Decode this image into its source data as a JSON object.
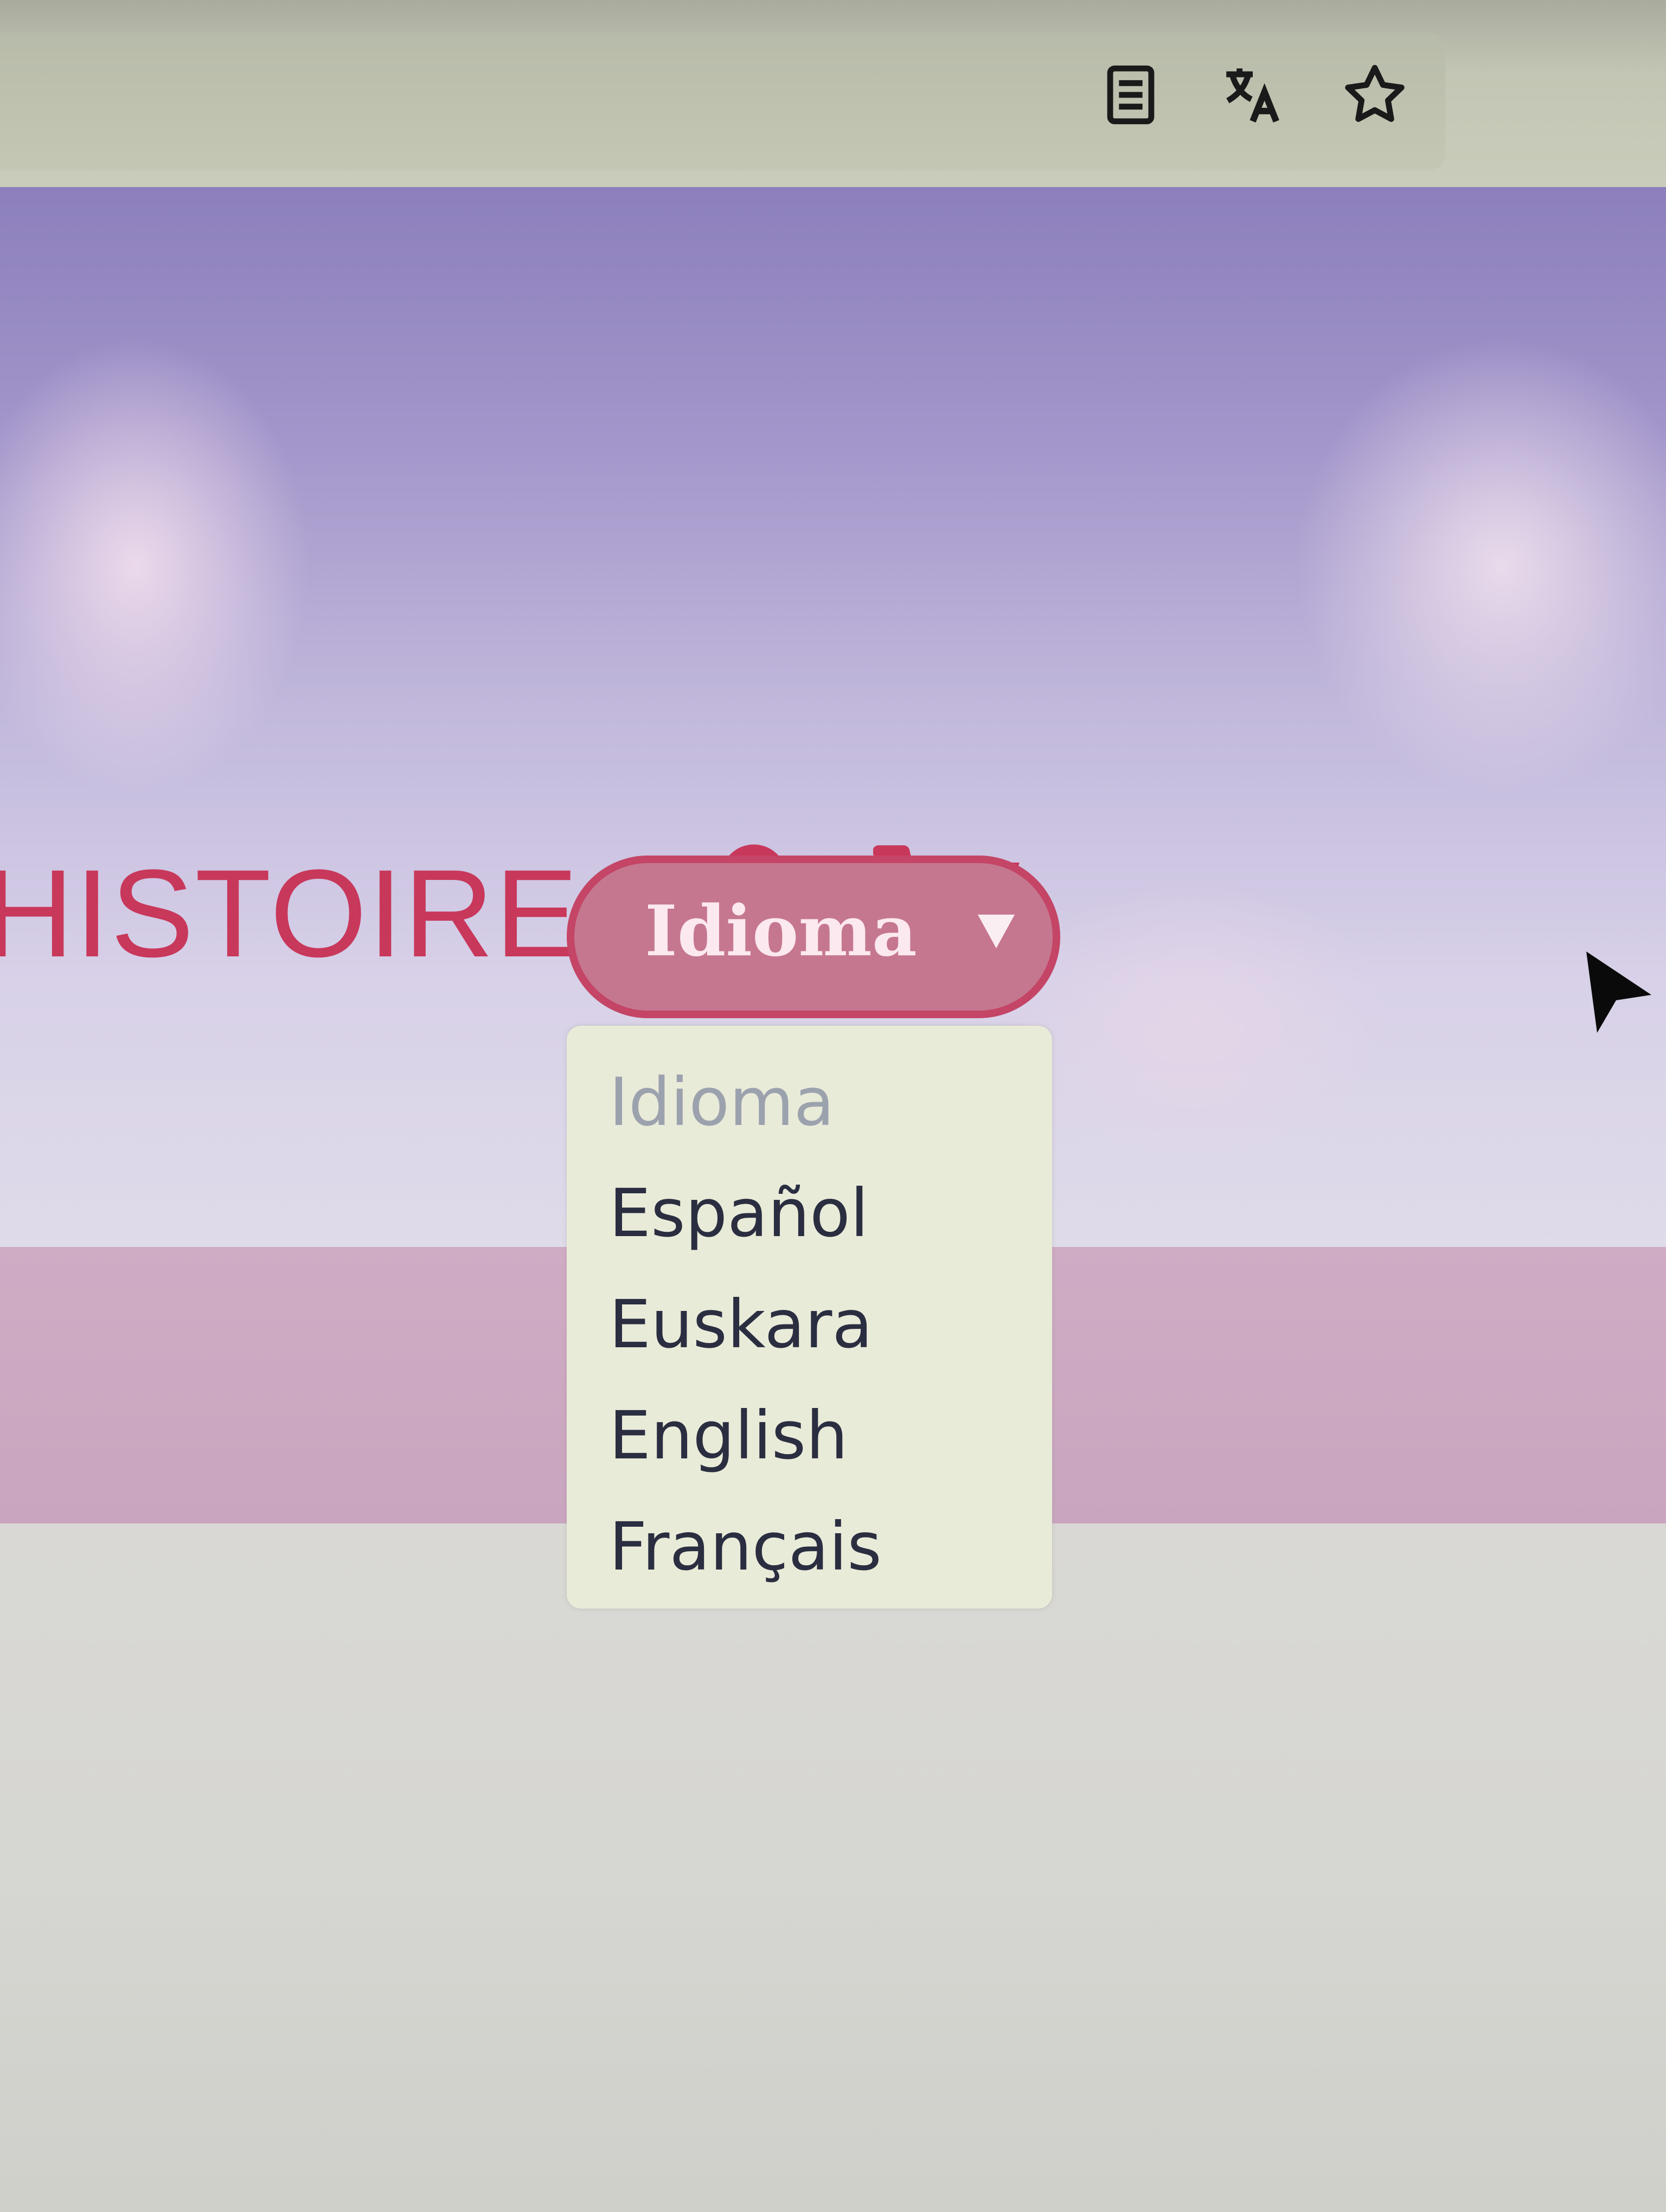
{
  "browser": {
    "icons": [
      "reader-view-icon",
      "translate-icon",
      "bookmark-star-icon"
    ]
  },
  "header": {
    "brand_text": "HISTOIRES",
    "icons": [
      "user-icon",
      "cart-icon"
    ],
    "accent_color": "#c8385b"
  },
  "language_select": {
    "selected_label": "Idioma",
    "options": [
      {
        "label": "Idioma",
        "placeholder": true
      },
      {
        "label": "Español",
        "placeholder": false
      },
      {
        "label": "Euskara",
        "placeholder": false
      },
      {
        "label": "English",
        "placeholder": false
      },
      {
        "label": "Français",
        "placeholder": false
      }
    ]
  },
  "colors": {
    "select_fill": "#c67790",
    "select_border": "#c44566",
    "dropdown_bg": "#e9ebd9",
    "band": "#cfabc4"
  }
}
